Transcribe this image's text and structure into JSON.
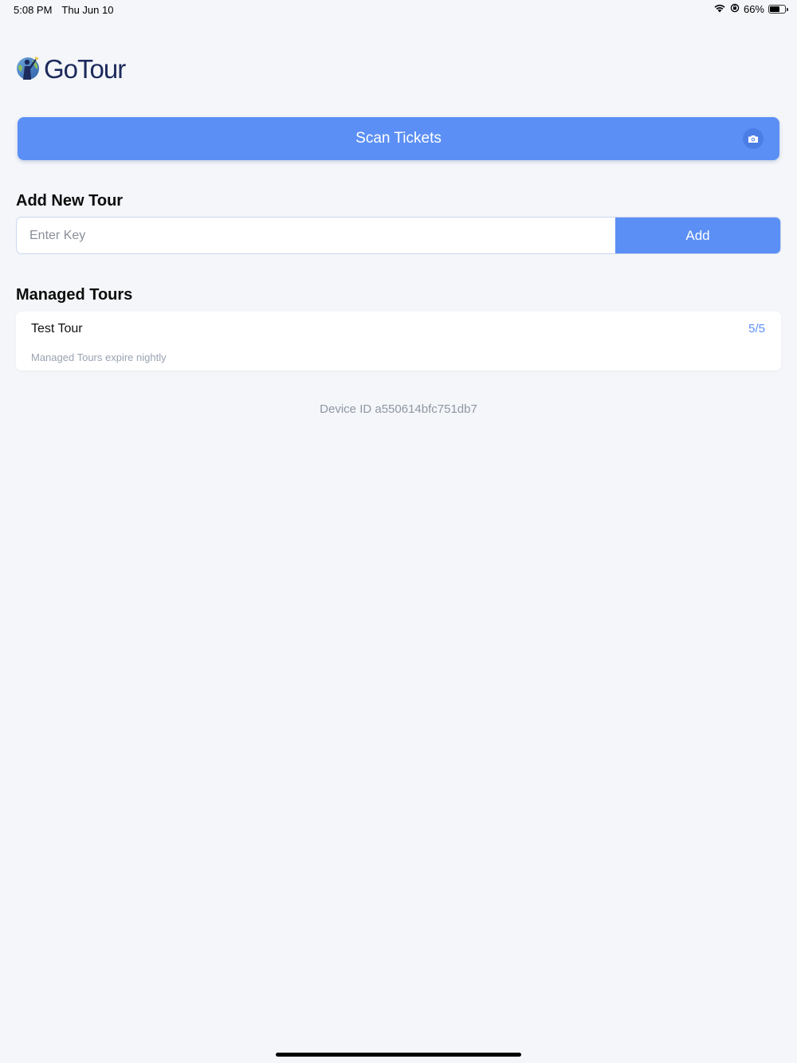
{
  "status_bar": {
    "time": "5:08 PM",
    "date": "Thu Jun 10",
    "battery_percent": "66%",
    "battery_level": 0.66,
    "icons": [
      "wifi-icon",
      "orientation-lock-icon",
      "battery-icon"
    ]
  },
  "app": {
    "logo_text": "GoTour",
    "logo_icon": "globe-figure-logo"
  },
  "scan": {
    "label": "Scan Tickets",
    "icon": "camera-icon"
  },
  "add_tour": {
    "heading": "Add New Tour",
    "input_placeholder": "Enter Key",
    "input_value": "",
    "button_label": "Add"
  },
  "managed_tours": {
    "heading": "Managed Tours",
    "items": [
      {
        "name": "Test Tour",
        "count": "5/5"
      }
    ],
    "note": "Managed Tours expire nightly"
  },
  "device": {
    "label": "Device ID a550614bfc751db7"
  },
  "colors": {
    "accent": "#5b8ff5",
    "background": "#f4f6f9",
    "logo_text": "#1d2a5c"
  }
}
